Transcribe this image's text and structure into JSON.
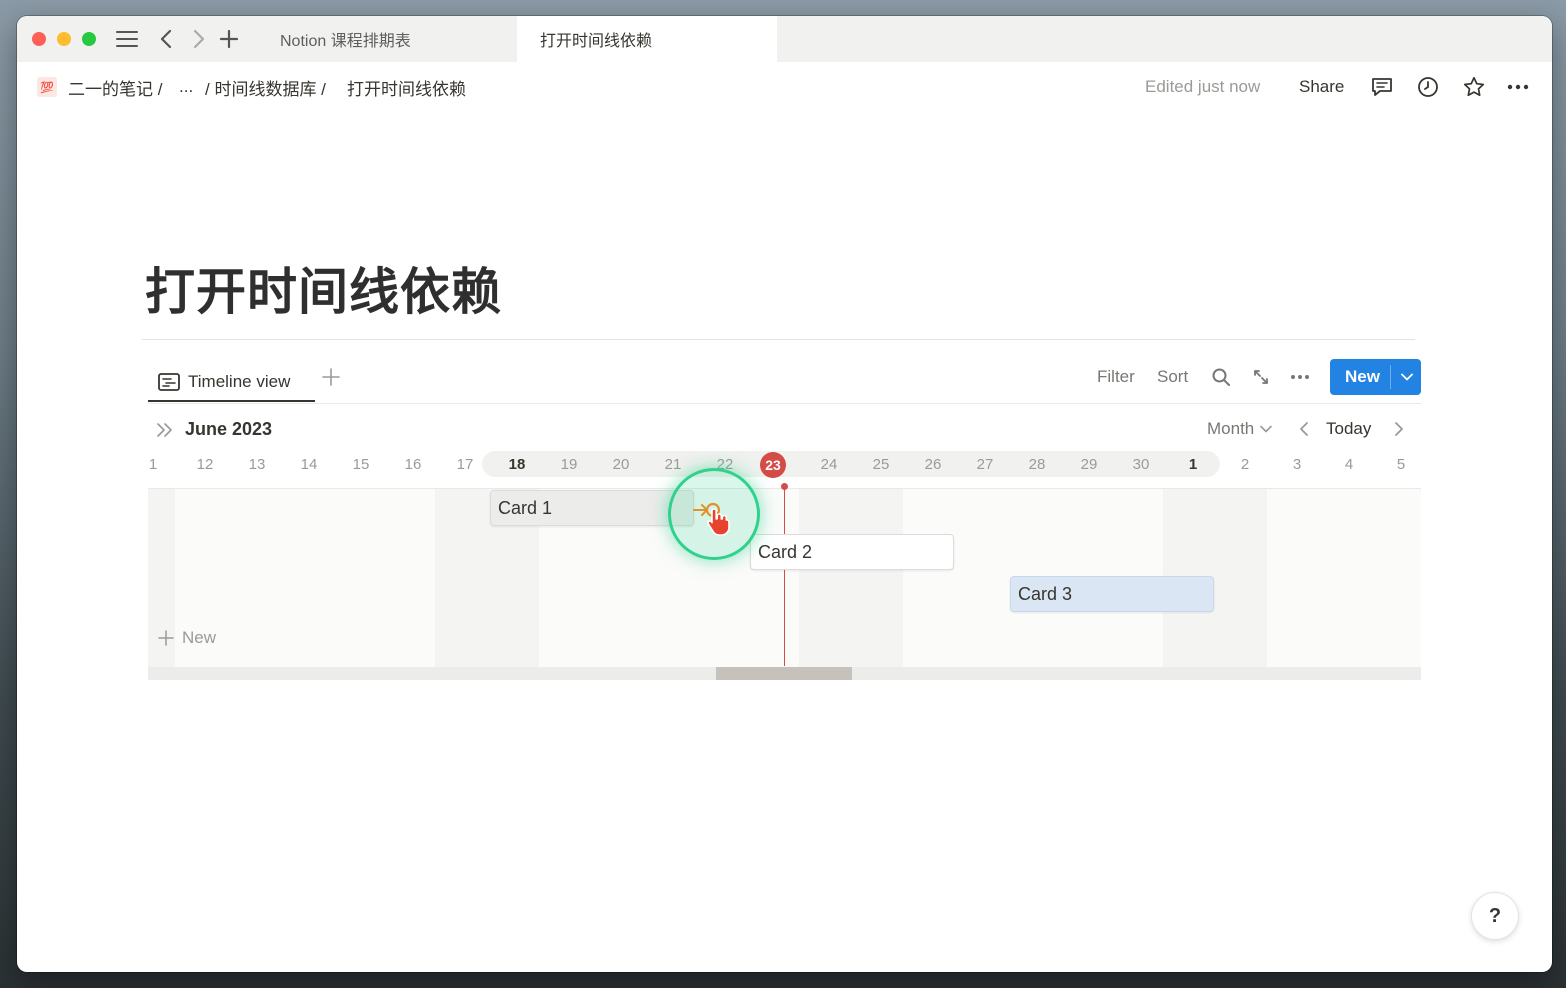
{
  "window": {
    "tabs": [
      {
        "label": "Notion 课程排期表"
      },
      {
        "label": "打开时间线依赖"
      }
    ]
  },
  "breadcrumb": {
    "emoji": "💯",
    "items": [
      "二一的笔记 /",
      "... ",
      "/ 时间线数据库 /",
      "打开时间线依赖"
    ]
  },
  "topbar": {
    "edited": "Edited just now",
    "share": "Share"
  },
  "page": {
    "title": "打开时间线依赖"
  },
  "view": {
    "tab_label": "Timeline view",
    "filter": "Filter",
    "sort": "Sort",
    "new_label": "New"
  },
  "timeline": {
    "month": "June 2023",
    "scale": "Month",
    "today_label": "Today",
    "days": [
      "1",
      "12",
      "13",
      "14",
      "15",
      "16",
      "17",
      "18",
      "19",
      "20",
      "21",
      "22",
      "23",
      "24",
      "25",
      "26",
      "27",
      "28",
      "29",
      "30",
      "1",
      "2",
      "3",
      "4",
      "5"
    ],
    "today_day": "23",
    "cards": [
      {
        "label": "Card 1"
      },
      {
        "label": "Card 2"
      },
      {
        "label": "Card 3"
      }
    ],
    "add_row": "New"
  },
  "help": "?",
  "colors": {
    "accent": "#2383e2",
    "today": "#d44c47",
    "highlight": "#2fd18d"
  }
}
